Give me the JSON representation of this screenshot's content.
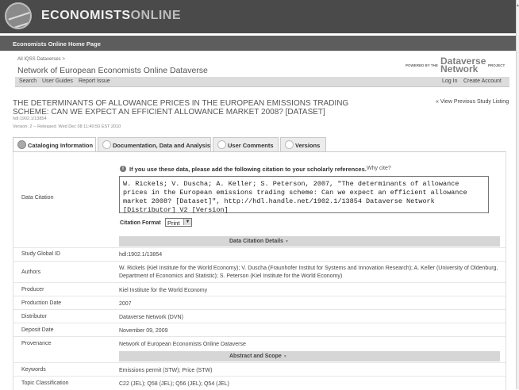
{
  "header": {
    "logo_text_a": "ECONOMISTS",
    "logo_text_b": "ONLINE",
    "home_link": "Economists Online Home Page"
  },
  "dataverse": {
    "breadcrumb": "All IQSS Dataverses  >",
    "title": "Network of European Economists Online Dataverse",
    "powered_by": "POWERED BY THE",
    "dvn_logo_line1": "Dataverse",
    "dvn_logo_line2": "Network",
    "project": "PROJECT"
  },
  "nav": {
    "search": "Search",
    "user_guides": "User Guides",
    "report_issue": "Report Issue",
    "log_in": "Log In",
    "create_account": "Create Account"
  },
  "study": {
    "title": "THE DETERMINANTS OF ALLOWANCE PRICES IN THE EUROPEAN EMISSIONS TRADING SCHEME: CAN WE EXPECT AN EFFICIENT ALLOWANCE MARKET 2008? [DATASET]",
    "view_previous": "« View Previous Study Listing",
    "handle": "hdl:1902.1/13854",
    "version": "Version: 2 -- Released: Wed Dec 08 11:40:50 EST 2010"
  },
  "tabs": [
    {
      "label": "Cataloging Information"
    },
    {
      "label": "Documentation, Data and Analysis"
    },
    {
      "label": "User Comments"
    },
    {
      "label": "Versions"
    }
  ],
  "citation": {
    "note": "If you use these data, please add the following citation to your scholarly references.",
    "why_cite": "Why cite?",
    "label": "Data Citation",
    "text": "W. Rickels; V. Duscha; A. Keller; S. Peterson, 2007, \"The determinants of allowance prices in the European emissions trading scheme: Can we expect an efficient allowance market 2008? [Dataset]\", http://hdl.handle.net/1902.1/13854 Dataverse Network [Distributor] V2 [Version]",
    "format_label": "Citation Format",
    "format_value": "Print",
    "format_arrow": "▼"
  },
  "sections": {
    "details_title": "Data Citation Details",
    "abstract_title": "Abstract and Scope",
    "toggle_glyph": "▼"
  },
  "details": [
    {
      "label": "Study Global ID",
      "value": "hdl:1902.1/13854"
    },
    {
      "label": "Authors",
      "value": "W. Rickels (Kiel Institute for the World Economy); V. Duscha (Fraunhofer Institut for Systems and Innovation Research); A. Keller (University of Oldenburg, Department of Economics and Statistic); S. Peterson (Kiel Institute for the World Economy)"
    },
    {
      "label": "Producer",
      "value": "Kiel Institute for the World Economy"
    },
    {
      "label": "Production Date",
      "value": "2007"
    },
    {
      "label": "Distributor",
      "value": "Dataverse Network (DVN)"
    },
    {
      "label": "Deposit Date",
      "value": "November 09, 2009"
    },
    {
      "label": "Provenance",
      "value": "Network of European Economists Online Dataverse"
    }
  ],
  "abstract": [
    {
      "label": "Keywords",
      "value": "Emissions permit (STW); Price (STW)"
    },
    {
      "label": "Topic Classification",
      "value": "C22 (JEL); Q58 (JEL); Q56 (JEL); Q54 (JEL)"
    }
  ]
}
